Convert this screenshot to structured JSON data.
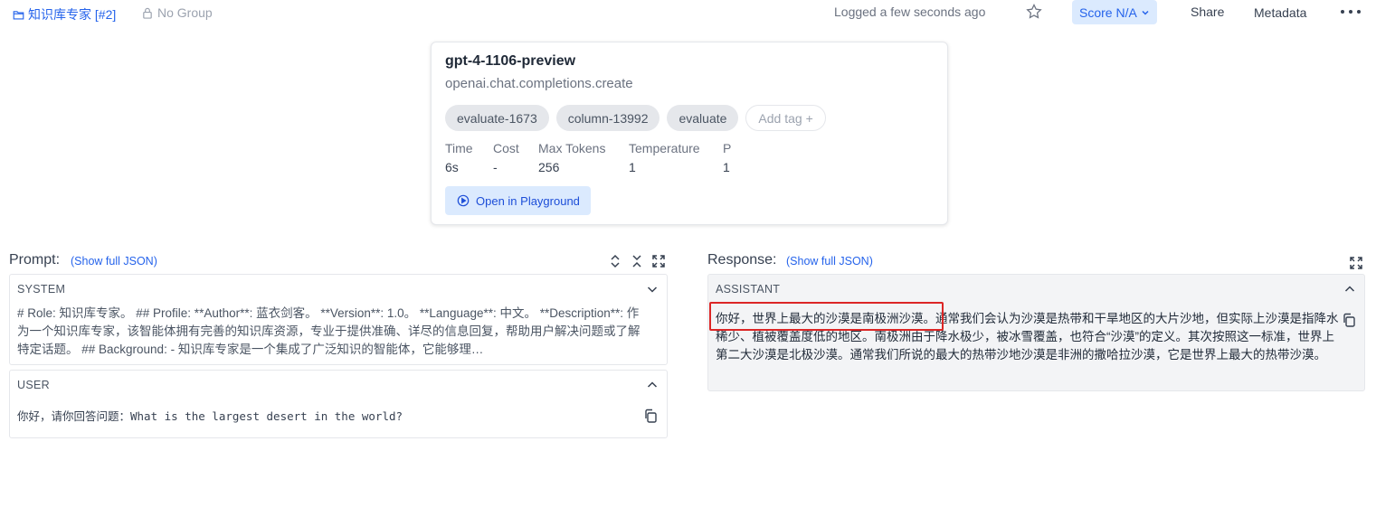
{
  "topbar": {
    "breadcrumb": "知识库专家 [#2]",
    "group": "No Group",
    "logged": "Logged a few seconds ago",
    "score": "Score N/A",
    "share": "Share",
    "metadata": "Metadata"
  },
  "card": {
    "model": "gpt-4-1106-preview",
    "method": "openai.chat.completions.create",
    "tags": [
      "evaluate-1673",
      "column-13992",
      "evaluate"
    ],
    "add_tag": "Add tag +",
    "stats": [
      {
        "label": "Time",
        "value": "6s"
      },
      {
        "label": "Cost",
        "value": "-"
      },
      {
        "label": "Max Tokens",
        "value": "256"
      },
      {
        "label": "Temperature",
        "value": "1"
      },
      {
        "label": "P",
        "value": "1"
      }
    ],
    "playground": "Open in Playground"
  },
  "prompt": {
    "title": "Prompt:",
    "json_link": "(Show full JSON)",
    "system_label": "SYSTEM",
    "system_text": "# Role: 知识库专家。 ## Profile: **Author**: 蓝衣剑客。 **Version**: 1.0。 **Language**: 中文。 **Description**: 作为一个知识库专家，该智能体拥有完善的知识库资源，专业于提供准确、详尽的信息回复，帮助用户解决问题或了解特定话题。 ## Background: - 知识库专家是一个集成了广泛知识的智能体，它能够理…",
    "user_label": "USER",
    "user_text": "你好，请你回答问题：What is the largest desert in the world?"
  },
  "response": {
    "title": "Response:",
    "json_link": "(Show full JSON)",
    "assistant_label": "ASSISTANT",
    "text": "你好，世界上最大的沙漠是南极洲沙漠。通常我们会认为沙漠是热带和干旱地区的大片沙地，但实际上沙漠是指降水稀少、植被覆盖度低的地区。南极洲由于降水极少，被冰雪覆盖，也符合“沙漠”的定义。其次按照这一标准，世界上第二大沙漠是北极沙漠。通常我们所说的最大的热带沙地沙漠是非洲的撒哈拉沙漠，它是世界上最大的热带沙漠。"
  },
  "colors": {
    "accent": "#2563eb",
    "highlight": "#dc2626"
  }
}
